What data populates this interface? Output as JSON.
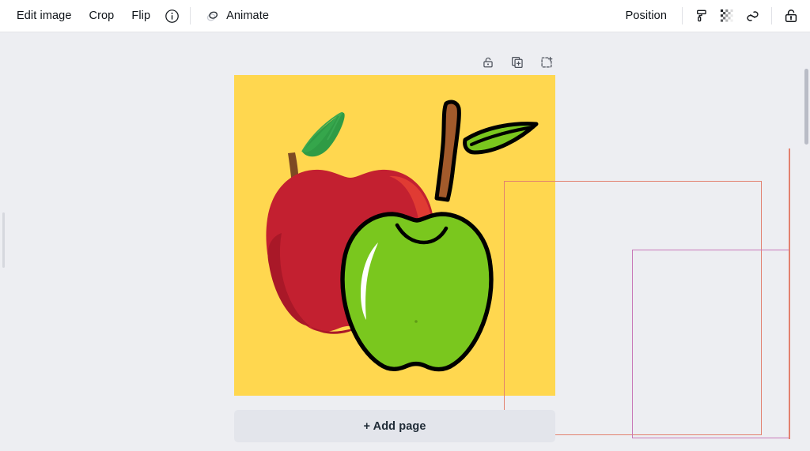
{
  "toolbar": {
    "left_items": [
      {
        "label": "Edit image",
        "name": "edit-image-button"
      },
      {
        "label": "Crop",
        "name": "crop-button"
      },
      {
        "label": "Flip",
        "name": "flip-button"
      }
    ],
    "info_icon": "info-icon",
    "animate": {
      "label": "Animate",
      "icon": "animate-icon"
    },
    "position_label": "Position",
    "right_icons": [
      {
        "name": "paint-roller-icon",
        "title": "Copy style"
      },
      {
        "name": "transparency-icon",
        "title": "Transparency"
      },
      {
        "name": "link-icon",
        "title": "Link"
      },
      {
        "name": "lock-open-icon",
        "title": "Lock"
      }
    ]
  },
  "page_tools": [
    {
      "name": "lock-page-icon",
      "title": "Lock page"
    },
    {
      "name": "duplicate-page-icon",
      "title": "Duplicate page"
    },
    {
      "name": "add-page-icon",
      "title": "Add page"
    }
  ],
  "canvas": {
    "background_color": "#ffd74f",
    "selection_outer_color": "#e2816f",
    "selection_inner_color": "#c878b8",
    "artwork_name": "two-apples-illustration",
    "red_apple_color": "#c8202f",
    "green_apple_color": "#76cc1a",
    "leaf_color": "#2b9b45",
    "stem_color": "#8a4f27"
  },
  "add_page": {
    "label": "+ Add page"
  },
  "scrollbar": {
    "name": "vertical-scrollbar"
  }
}
